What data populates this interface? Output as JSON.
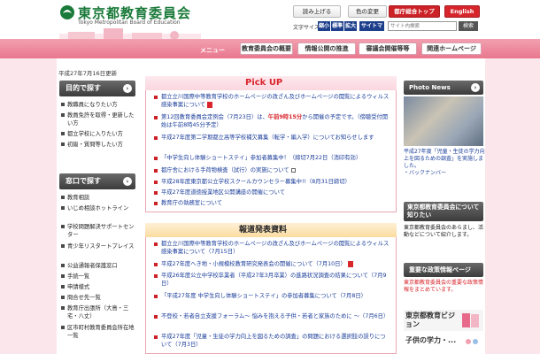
{
  "header": {
    "title": "東京都教育委員会",
    "subtitle": "Tokyo Metropolitan Board of Education",
    "btn_read": "読み上げる",
    "btn_color": "色の変更",
    "btn_top": "都庁総合トップ",
    "btn_en": "English",
    "fs_label": "文字サイズ",
    "fs_small": "縮小",
    "fs_std": "標準",
    "fs_large": "拡大",
    "sitemap": "サイトマップ",
    "search_placeholder": "サイト内検索",
    "search_btn": "検索"
  },
  "menu": {
    "label": "メニュー",
    "items": [
      "教育委員会の概要",
      "情報公開の推進",
      "審議会開催等等",
      "関連ホームページ"
    ]
  },
  "date": "平成27年7月16日更新",
  "nav1": {
    "title": "目的で探す",
    "items": [
      "教職員になりたい方",
      "教員免許を取得・更新したい方",
      "都立学校に入りたい方",
      "初級・質問等したい方"
    ]
  },
  "nav2": {
    "title": "窓口で探す",
    "items": [
      "教育相談",
      "いじめ相談ホットライン",
      "学校問題解決サポートセンター",
      "青少年リスタートプレイス",
      "公益通報者保護窓口",
      "手続一覧",
      "申請様式",
      "問合せ先一覧",
      "教育庁出張所（大島・三宅・八丈）",
      "区市町村教育委員会所在地一覧"
    ]
  },
  "pickup": {
    "title": "Pick UP",
    "items": [
      "都立立川国際中等教育学校のホームページの改ざん及びホームページの閲覧によるウィルス感染事案について",
      "第12回教育委員会定例会（7月23日）は、午前9時15分から開催の予定です。（傍聴受付開始は午前8時45分予定）",
      "平成27年度第二学期都立高等学校補欠募集（転学・編入学）についてお知らせします",
      "「中学生向し体験ショートステイ」参加者募集中！（締切7月22日（消印有効）",
      "都庁舎における手荷物検査（試行）の実施について",
      "平成28年度東京都公立学校スクールカウンセラー募集中!!（8月31日締切）",
      "平成27年度道徳授業地区公開講座の開催について",
      "教育庁の執務室について"
    ],
    "red_text": "午前9時15分"
  },
  "press": {
    "title": "報道発表資料",
    "items": [
      "都立立川国際中等教育学校のホームページの改ざん及びホームページの閲覧によるウィルス感染事案について（7月15日）",
      "平成27年度へき地・小規模校教育研究発表会の開催について（7月10日）",
      "平成26年度公立中学校卒業者（平成27年3月卒業）の進路状況調査の結果について（7月9日）",
      "「平成27年度 中学生向し体験ショートステイ」の参加者募集について（7月8日）",
      "不登校・若者自立支援フォーラム～ 悩みを抱える子供・若者と家族のために ～（7月6日）",
      "平成27年度「児童・生徒の学力向上を図るための調査」の問題における選択肢の誤りについて（7月3日）"
    ]
  },
  "right": {
    "photo_title": "Photo News",
    "photo_caption": "平成27年度「児童・生徒の学力向上を図るための調査」を実施しました。",
    "photo_more": "バックナンバー",
    "about_title": "東京都教育委員会について知りたい",
    "about_text": "東京都教育委員会のあらまし、活動などについて紹介します。",
    "policy_title": "重要な政策情報ページ",
    "policy_text": "東京都教育委員会の重要な政策情報をまとめています。",
    "vision": "東京都教育ビジョン",
    "vision2": "子供の学力・..."
  },
  "colors": {
    "brand_green": "#1a7a3a",
    "accent_red": "#cc2127",
    "menu_pink": "#e9778e",
    "link_blue": "#1a3d9a"
  }
}
